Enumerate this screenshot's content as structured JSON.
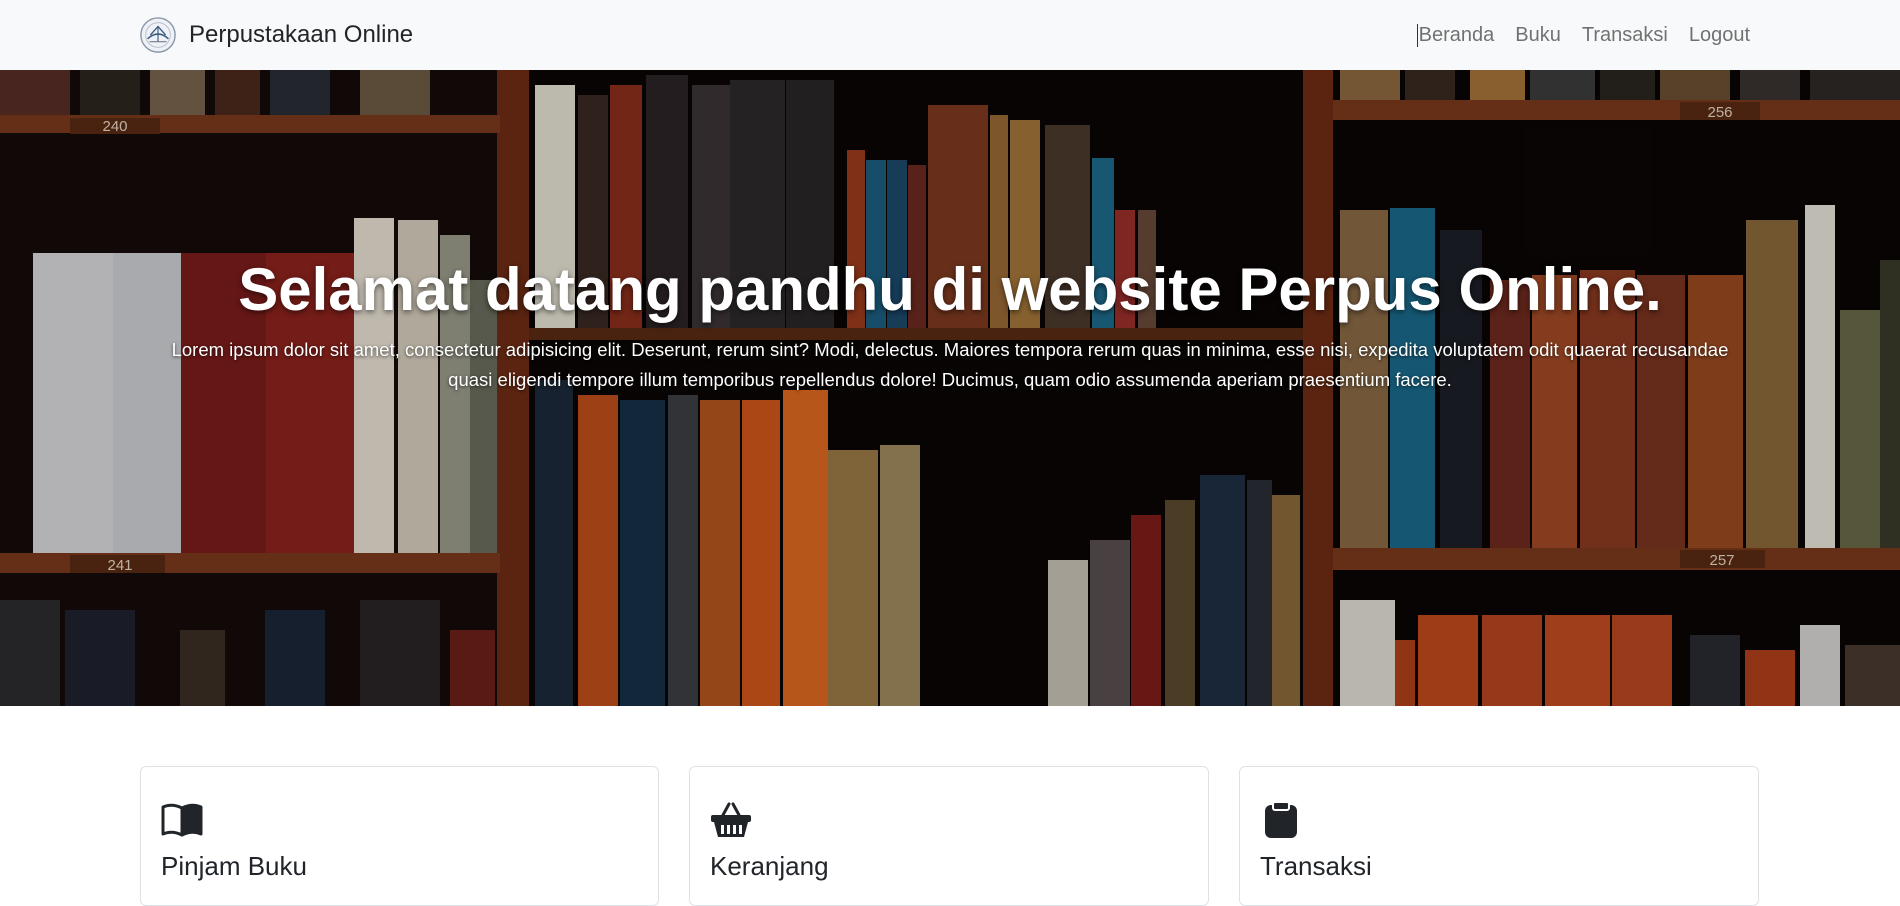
{
  "navbar": {
    "brand": "Perpustakaan Online",
    "links": [
      "Beranda",
      "Buku",
      "Transaksi",
      "Logout"
    ]
  },
  "hero": {
    "title": "Selamat datang pandhu di website Perpus Online.",
    "subtitle_line1": "Lorem ipsum dolor sit amet, consectetur adipisicing elit. Deserunt, rerum sint? Modi, delectus. Maiores tempora rerum quas in minima, esse nisi, expedita voluptatem odit quaerat recusandae",
    "subtitle_line2": "quasi eligendi tempore illum temporibus repellendus dolore! Ducimus, quam odio assumenda aperiam praesentium facere.",
    "shelf_numbers": [
      "240",
      "256",
      "241",
      "257"
    ]
  },
  "cards": [
    {
      "title": "Pinjam Buku",
      "icon": "book-open-icon"
    },
    {
      "title": "Keranjang",
      "icon": "basket-icon"
    },
    {
      "title": "Transaksi",
      "icon": "clipboard-icon"
    }
  ]
}
